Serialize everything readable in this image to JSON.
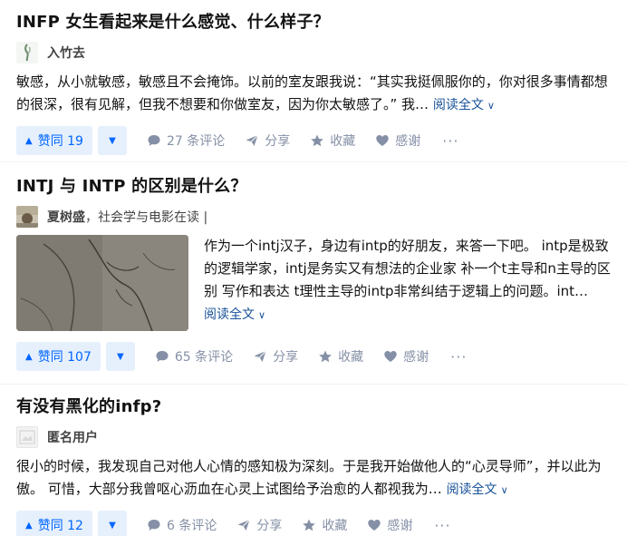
{
  "colors": {
    "accent": "#0066ff",
    "vote_bg": "#e6f0fd",
    "meta": "#8590a6",
    "link": "#175199"
  },
  "icons": {
    "vote_up": "triangle-up-icon",
    "vote_down": "triangle-down-icon",
    "comment": "comment-icon",
    "share": "paper-plane-icon",
    "favorite": "star-icon",
    "thanks": "heart-icon",
    "more": "ellipsis-icon",
    "expand": "chevron-down-icon"
  },
  "cards": [
    {
      "title": "INFP 女生看起来是什么感觉、什么样子？",
      "author": {
        "name": "入竹去",
        "bio": ""
      },
      "excerpt": "敏感，从小就敏感，敏感且不会掩饰。以前的室友跟我说：“其实我挺佩服你的，你对很多事情都想的很深，很有见解，但我不想要和你做室友，因为你太敏感了。” 我…",
      "read_more": "阅读全文",
      "vote_count": "赞同 19",
      "comments": "27 条评论",
      "share": "分享",
      "favorite": "收藏",
      "thanks": "感谢",
      "more": "···"
    },
    {
      "title": "INTJ 与 INTP 的区别是什么？",
      "author": {
        "name": "夏树盛",
        "bio": "，社会学与电影在读 |"
      },
      "excerpt": "作为一个intj汉子，身边有intp的好朋友，来答一下吧。 intp是极致的逻辑学家，intj是务实又有想法的企业家 补一个t主导和n主导的区别 写作和表达 t理性主导的intp非常纠结于逻辑上的问题。int…",
      "read_more": "阅读全文",
      "vote_count": "赞同 107",
      "comments": "65 条评论",
      "share": "分享",
      "favorite": "收藏",
      "thanks": "感谢",
      "more": "···"
    },
    {
      "title": "有没有黑化的infp?",
      "author": {
        "name": "匿名用户",
        "bio": ""
      },
      "excerpt": "很小的时候，我发现自己对他人心情的感知极为深刻。于是我开始做他人的“心灵导师”，并以此为傲。 可惜，大部分我曾呕心沥血在心灵上试图给予治愈的人都视我为…",
      "read_more": "阅读全文",
      "vote_count": "赞同 12",
      "comments": "6 条评论",
      "share": "分享",
      "favorite": "收藏",
      "thanks": "感谢",
      "more": "···"
    }
  ]
}
